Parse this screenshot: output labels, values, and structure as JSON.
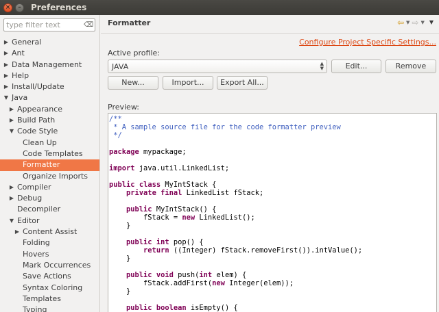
{
  "window": {
    "title": "Preferences",
    "close_glyph": "×",
    "min_glyph": "–"
  },
  "filter": {
    "placeholder": "type filter text",
    "clear_glyph": "⌫"
  },
  "tree": [
    {
      "label": "General",
      "depth": 0,
      "expander": "collapsed"
    },
    {
      "label": "Ant",
      "depth": 0,
      "expander": "collapsed"
    },
    {
      "label": "Data Management",
      "depth": 0,
      "expander": "collapsed"
    },
    {
      "label": "Help",
      "depth": 0,
      "expander": "collapsed"
    },
    {
      "label": "Install/Update",
      "depth": 0,
      "expander": "collapsed"
    },
    {
      "label": "Java",
      "depth": 0,
      "expander": "expanded"
    },
    {
      "label": "Appearance",
      "depth": 1,
      "expander": "collapsed"
    },
    {
      "label": "Build Path",
      "depth": 1,
      "expander": "collapsed"
    },
    {
      "label": "Code Style",
      "depth": 1,
      "expander": "expanded"
    },
    {
      "label": "Clean Up",
      "depth": 2,
      "expander": "none"
    },
    {
      "label": "Code Templates",
      "depth": 2,
      "expander": "none"
    },
    {
      "label": "Formatter",
      "depth": 2,
      "expander": "none",
      "selected": true
    },
    {
      "label": "Organize Imports",
      "depth": 2,
      "expander": "none"
    },
    {
      "label": "Compiler",
      "depth": 1,
      "expander": "collapsed"
    },
    {
      "label": "Debug",
      "depth": 1,
      "expander": "collapsed"
    },
    {
      "label": "Decompiler",
      "depth": 1,
      "expander": "none"
    },
    {
      "label": "Editor",
      "depth": 1,
      "expander": "expanded"
    },
    {
      "label": "Content Assist",
      "depth": 2,
      "expander": "collapsed"
    },
    {
      "label": "Folding",
      "depth": 2,
      "expander": "none"
    },
    {
      "label": "Hovers",
      "depth": 2,
      "expander": "none"
    },
    {
      "label": "Mark Occurrences",
      "depth": 2,
      "expander": "none"
    },
    {
      "label": "Save Actions",
      "depth": 2,
      "expander": "none"
    },
    {
      "label": "Syntax Coloring",
      "depth": 2,
      "expander": "none"
    },
    {
      "label": "Templates",
      "depth": 2,
      "expander": "none"
    },
    {
      "label": "Typing",
      "depth": 2,
      "expander": "none"
    }
  ],
  "page": {
    "title": "Formatter",
    "nav": {
      "back_glyph": "⇦",
      "back_menu_glyph": "▼",
      "forward_glyph": "⇨",
      "forward_menu_glyph": "▼",
      "view_menu_glyph": "▼"
    },
    "configure_link": "Configure Project Specific Settings...",
    "active_profile_label": "Active profile:",
    "profile_value": "JAVA",
    "profile_arrows_up": "▲",
    "profile_arrows_down": "▼",
    "buttons": {
      "edit": "Edit...",
      "remove": "Remove",
      "new": "New...",
      "import": "Import...",
      "export_all": "Export All..."
    },
    "preview_label": "Preview:",
    "code_lines": [
      [
        {
          "t": "/**",
          "c": "cm"
        }
      ],
      [
        {
          "t": " * A sample source file for the code formatter preview",
          "c": "cm"
        }
      ],
      [
        {
          "t": " */",
          "c": "cm"
        }
      ],
      [],
      [
        {
          "t": "package",
          "c": "kw"
        },
        {
          "t": " mypackage;"
        }
      ],
      [],
      [
        {
          "t": "import",
          "c": "kw"
        },
        {
          "t": " java.util.LinkedList;"
        }
      ],
      [],
      [
        {
          "t": "public",
          "c": "kw"
        },
        {
          "t": " "
        },
        {
          "t": "class",
          "c": "kw"
        },
        {
          "t": " MyIntStack {"
        }
      ],
      [
        {
          "t": "    "
        },
        {
          "t": "private",
          "c": "kw"
        },
        {
          "t": " "
        },
        {
          "t": "final",
          "c": "kw"
        },
        {
          "t": " LinkedList fStack;"
        }
      ],
      [],
      [
        {
          "t": "    "
        },
        {
          "t": "public",
          "c": "kw"
        },
        {
          "t": " MyIntStack() {"
        }
      ],
      [
        {
          "t": "        fStack = "
        },
        {
          "t": "new",
          "c": "kw"
        },
        {
          "t": " LinkedList();"
        }
      ],
      [
        {
          "t": "    }"
        }
      ],
      [],
      [
        {
          "t": "    "
        },
        {
          "t": "public",
          "c": "kw"
        },
        {
          "t": " "
        },
        {
          "t": "int",
          "c": "kw"
        },
        {
          "t": " pop() {"
        }
      ],
      [
        {
          "t": "        "
        },
        {
          "t": "return",
          "c": "kw"
        },
        {
          "t": " ((Integer) fStack.removeFirst()).intValue();"
        }
      ],
      [
        {
          "t": "    }"
        }
      ],
      [],
      [
        {
          "t": "    "
        },
        {
          "t": "public",
          "c": "kw"
        },
        {
          "t": " "
        },
        {
          "t": "void",
          "c": "kw"
        },
        {
          "t": " push("
        },
        {
          "t": "int",
          "c": "kw"
        },
        {
          "t": " elem) {"
        }
      ],
      [
        {
          "t": "        fStack.addFirst("
        },
        {
          "t": "new",
          "c": "kw"
        },
        {
          "t": " Integer(elem));"
        }
      ],
      [
        {
          "t": "    }"
        }
      ],
      [],
      [
        {
          "t": "    "
        },
        {
          "t": "public",
          "c": "kw"
        },
        {
          "t": " "
        },
        {
          "t": "boolean",
          "c": "kw"
        },
        {
          "t": " isEmpty() {"
        }
      ]
    ]
  },
  "colors": {
    "selection": "#f07746",
    "link": "#dd4814",
    "keyword": "#7f0055",
    "comment": "#3f5fbf"
  }
}
